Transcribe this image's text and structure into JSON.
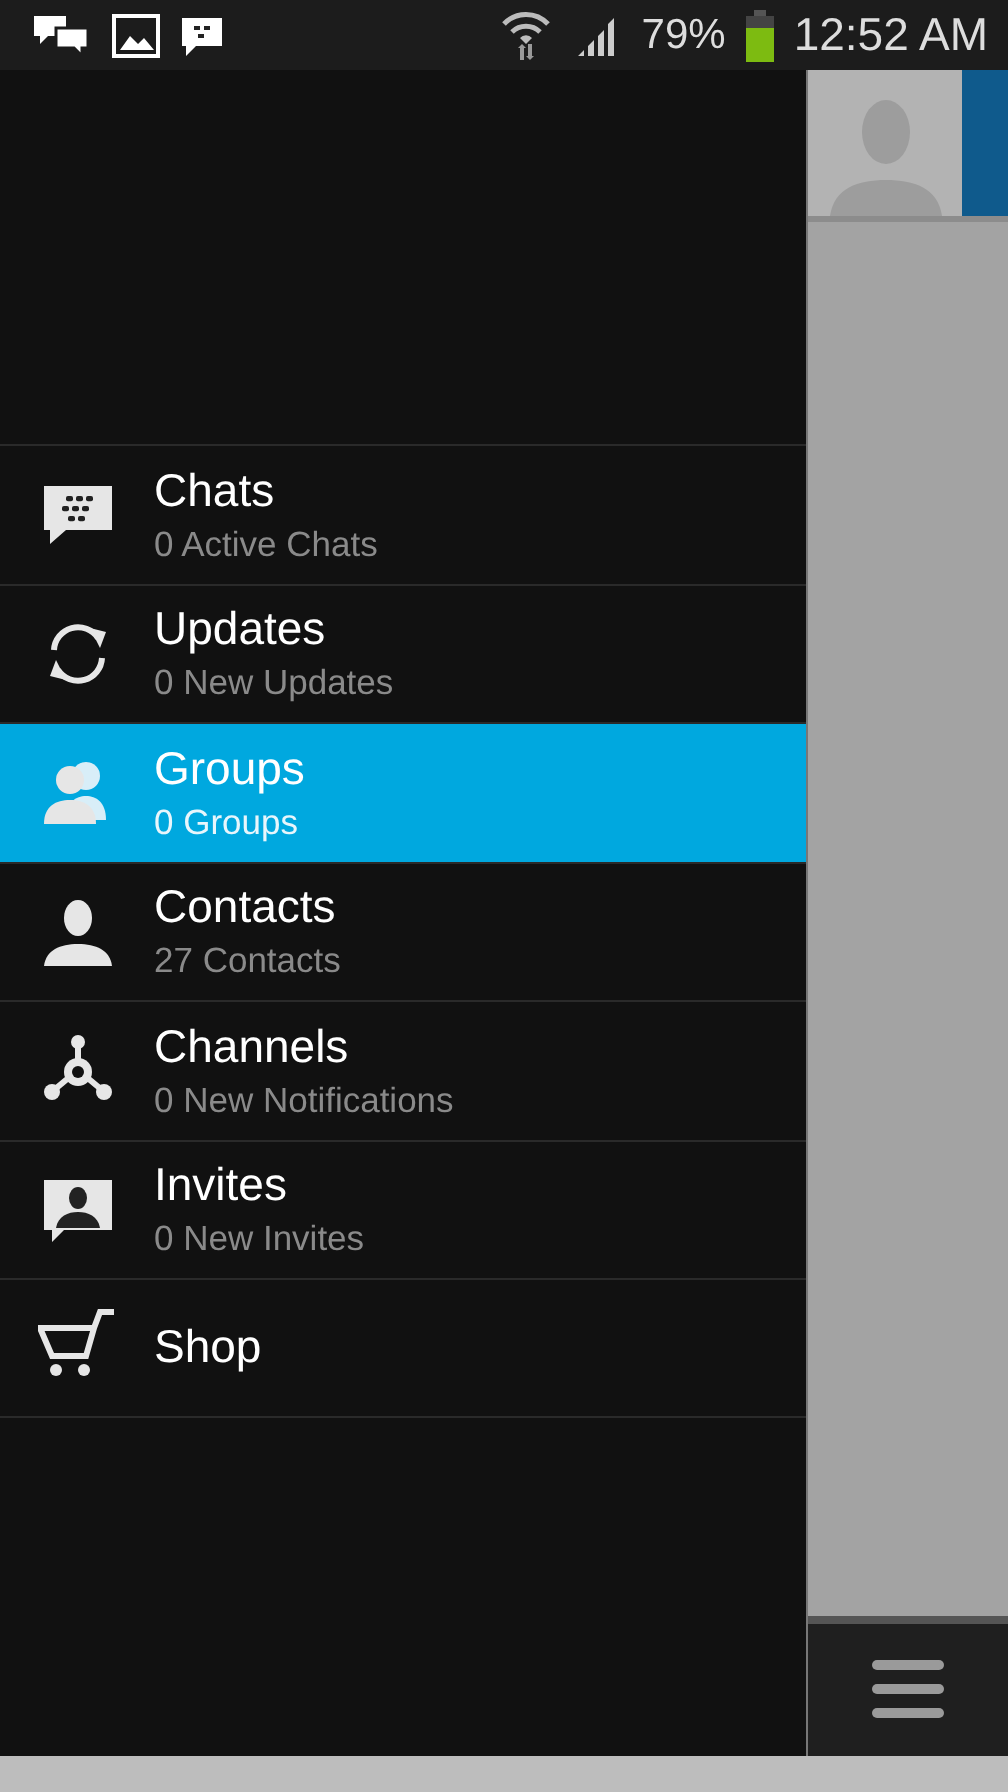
{
  "status_bar": {
    "battery": "79%",
    "time": "12:52 AM"
  },
  "menu": [
    {
      "title": "Chats",
      "subtitle": "0 Active Chats",
      "selected": false
    },
    {
      "title": "Updates",
      "subtitle": "0 New Updates",
      "selected": false
    },
    {
      "title": "Groups",
      "subtitle": "0 Groups",
      "selected": true
    },
    {
      "title": "Contacts",
      "subtitle": "27 Contacts",
      "selected": false
    },
    {
      "title": "Channels",
      "subtitle": "0 New Notifications",
      "selected": false
    },
    {
      "title": "Invites",
      "subtitle": "0 New Invites",
      "selected": false
    },
    {
      "title": "Shop",
      "selected": false
    }
  ]
}
